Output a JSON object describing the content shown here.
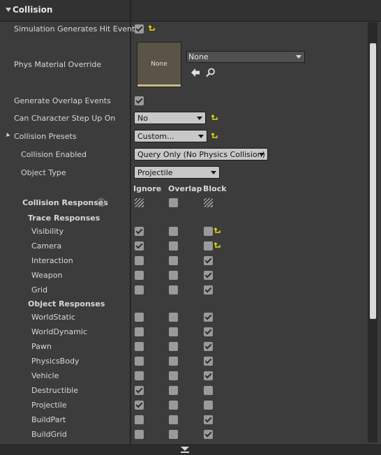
{
  "section": {
    "title": "Collision"
  },
  "props": {
    "sim_hit": {
      "label": "Simulation Generates Hit Events",
      "checked": true,
      "reset": true
    },
    "phys_mat": {
      "label": "Phys Material Override",
      "thumb_text": "None",
      "value": "None"
    },
    "overlap": {
      "label": "Generate Overlap Events",
      "checked": true
    },
    "step_up": {
      "label": "Can Character Step Up On",
      "value": "No",
      "reset": true
    },
    "presets": {
      "label": "Collision Presets",
      "value": "Custom...",
      "reset": true
    },
    "enabled": {
      "label": "Collision Enabled",
      "value": "Query Only (No Physics Collision)"
    },
    "object_type": {
      "label": "Object Type",
      "value": "Projectile"
    }
  },
  "columns": [
    "Ignore",
    "Overlap",
    "Block"
  ],
  "responses": {
    "label": "Collision Responses",
    "help_glyph": "?",
    "state": [
      "mixed",
      "off",
      "mixed"
    ]
  },
  "trace": {
    "label": "Trace Responses",
    "rows": [
      {
        "label": "Visibility",
        "state": [
          "on",
          "off",
          "off"
        ],
        "reset": true
      },
      {
        "label": "Camera",
        "state": [
          "on",
          "off",
          "off"
        ],
        "reset": true
      },
      {
        "label": "Interaction",
        "state": [
          "off",
          "off",
          "on"
        ],
        "reset": false
      },
      {
        "label": "Weapon",
        "state": [
          "off",
          "off",
          "on"
        ],
        "reset": false
      },
      {
        "label": "Grid",
        "state": [
          "off",
          "off",
          "on"
        ],
        "reset": false
      }
    ]
  },
  "object": {
    "label": "Object Responses",
    "rows": [
      {
        "label": "WorldStatic",
        "state": [
          "off",
          "off",
          "on"
        ]
      },
      {
        "label": "WorldDynamic",
        "state": [
          "off",
          "off",
          "on"
        ]
      },
      {
        "label": "Pawn",
        "state": [
          "off",
          "off",
          "on"
        ]
      },
      {
        "label": "PhysicsBody",
        "state": [
          "off",
          "off",
          "on"
        ]
      },
      {
        "label": "Vehicle",
        "state": [
          "off",
          "off",
          "on"
        ]
      },
      {
        "label": "Destructible",
        "state": [
          "on",
          "off",
          "off"
        ]
      },
      {
        "label": "Projectile",
        "state": [
          "on",
          "off",
          "off"
        ]
      },
      {
        "label": "BuildPart",
        "state": [
          "off",
          "off",
          "on"
        ]
      },
      {
        "label": "BuildGrid",
        "state": [
          "off",
          "off",
          "on"
        ]
      }
    ]
  },
  "colors": {
    "reset": "#e8e000",
    "panel": "#3c3c3c",
    "checkbox": "#9a9a9a"
  }
}
